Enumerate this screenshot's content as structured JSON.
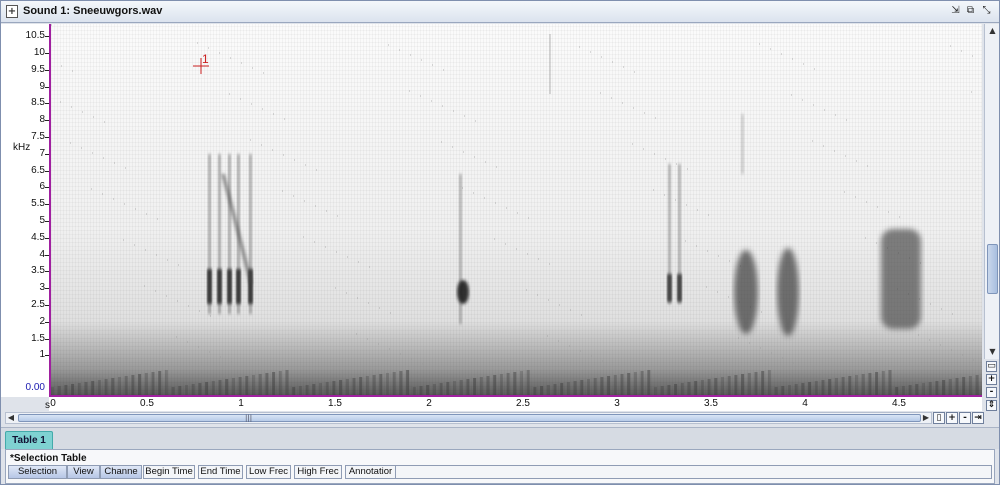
{
  "window": {
    "title": "Sound 1: Sneeuwgors.wav",
    "controls": [
      "restore-down-icon",
      "maximize-icon",
      "close-icon"
    ]
  },
  "spectrogram": {
    "y_unit": "kHz",
    "y_ticks": [
      "10.5",
      "10",
      "9.5",
      "9",
      "8.5",
      "8",
      "7.5",
      "7",
      "6.5",
      "6",
      "5.5",
      "5",
      "4.5",
      "4",
      "3.5",
      "3",
      "2.5",
      "2",
      "1.5",
      "1"
    ],
    "y_zero": "0.00",
    "x_unit": "s",
    "x_ticks": [
      "0",
      "0.5",
      "1",
      "1.5",
      "2",
      "2.5",
      "3",
      "3.5",
      "4",
      "4.5"
    ],
    "selection_marker": "1",
    "axis_color": "#a020a0",
    "marker_color": "#cc2222"
  },
  "zoom_controls": {
    "vertical": [
      "fit-icon",
      "+",
      "-",
      "fit-height-icon"
    ],
    "horizontal": [
      "fit-icon",
      "+",
      "-",
      "fit-width-icon"
    ]
  },
  "table": {
    "tab_label": "Table 1",
    "title": "*Selection Table",
    "columns": [
      "Selection",
      "View",
      "Channe",
      "Begin Time",
      "End Time",
      "Low Frec",
      "High Frec",
      "Annotatior"
    ]
  }
}
